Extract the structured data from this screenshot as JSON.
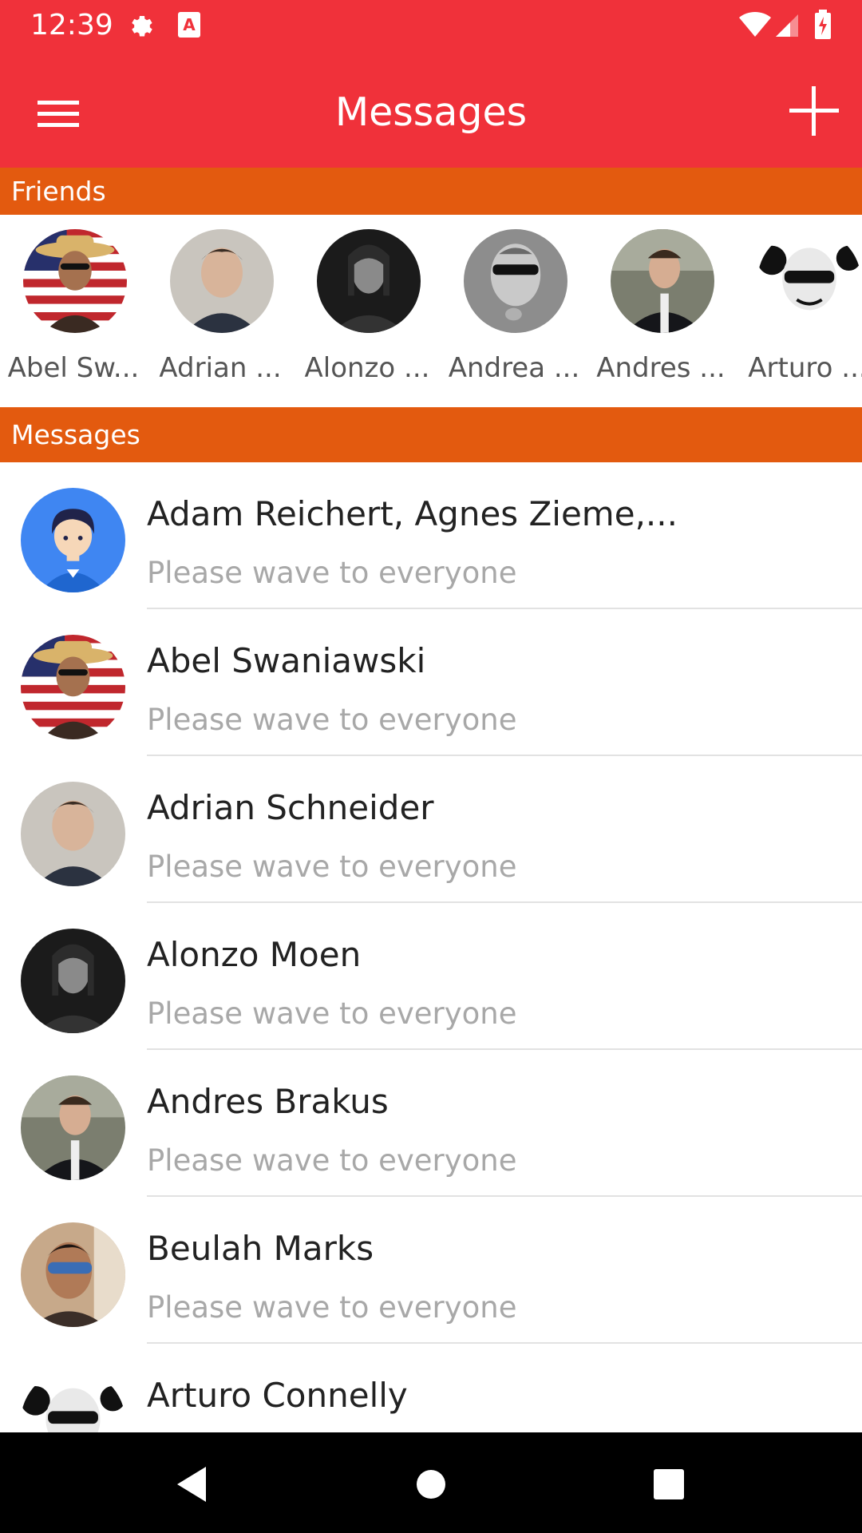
{
  "status": {
    "time": "12:39",
    "icons": [
      "settings-icon",
      "a-keyboard-icon",
      "wifi-icon",
      "signal-icon",
      "battery-charging-icon"
    ]
  },
  "appbar": {
    "title": "Messages",
    "menu_icon": "hamburger-menu-icon",
    "add_icon": "plus-icon"
  },
  "colors": {
    "primary": "#f0313a",
    "section": "#e35a0f",
    "navbar": "#000000"
  },
  "friends": {
    "header": "Friends",
    "items": [
      {
        "name": "Abel Sw..."
      },
      {
        "name": "Adrian ..."
      },
      {
        "name": "Alonzo ..."
      },
      {
        "name": "Andrea ..."
      },
      {
        "name": "Andres ..."
      },
      {
        "name": "Arturo ..."
      }
    ]
  },
  "messages": {
    "header": "Messages",
    "items": [
      {
        "title": "Adam Reichert, Agnes Zieme,...",
        "preview": "Please wave to everyone"
      },
      {
        "title": "Abel Swaniawski",
        "preview": "Please wave to everyone"
      },
      {
        "title": "Adrian Schneider",
        "preview": "Please wave to everyone"
      },
      {
        "title": "Alonzo Moen",
        "preview": "Please wave to everyone"
      },
      {
        "title": "Andres Brakus",
        "preview": "Please wave to everyone"
      },
      {
        "title": "Beulah Marks",
        "preview": "Please wave to everyone"
      },
      {
        "title": "Arturo Connelly",
        "preview": ""
      }
    ]
  },
  "navbar": {
    "back_icon": "back-triangle-icon",
    "home_icon": "home-circle-icon",
    "recents_icon": "recents-square-icon"
  }
}
